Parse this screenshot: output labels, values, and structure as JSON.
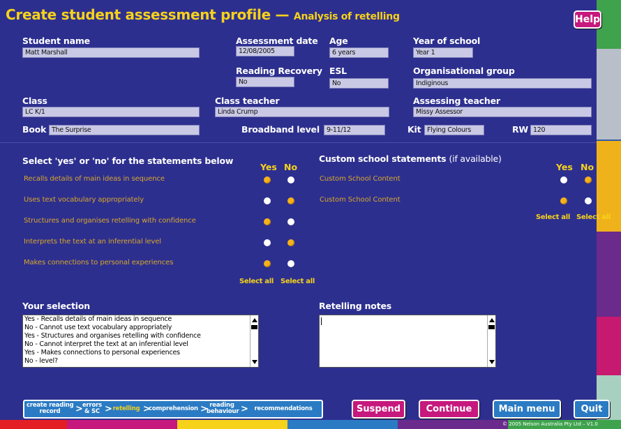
{
  "title": {
    "main": "Create student assessment profile",
    "dash": " — ",
    "sub": "Analysis of retelling"
  },
  "help_label": "Help",
  "fields": {
    "student_name": {
      "label": "Student name",
      "value": "Matt Marshall"
    },
    "assessment_date": {
      "label": "Assessment date",
      "value": "12/08/2005"
    },
    "age": {
      "label": "Age",
      "value": "6 years"
    },
    "year_of_school": {
      "label": "Year of school",
      "value": "Year 1"
    },
    "reading_recovery": {
      "label": "Reading Recovery",
      "value": "No"
    },
    "esl": {
      "label": "ESL",
      "value": "No"
    },
    "organisational_group": {
      "label": "Organisational group",
      "value": "Indiginous"
    },
    "class": {
      "label": "Class",
      "value": "LC K/1"
    },
    "class_teacher": {
      "label": "Class teacher",
      "value": "Linda Crump"
    },
    "assessing_teacher": {
      "label": "Assessing teacher",
      "value": "Missy Assessor"
    },
    "book": {
      "label": "Book",
      "value": "The Surprise"
    },
    "broadband_level": {
      "label": "Broadband level",
      "value": "9-11/12"
    },
    "kit": {
      "label": "Kit",
      "value": "Flying Colours"
    },
    "rw": {
      "label": "RW",
      "value": "120"
    }
  },
  "statements": {
    "heading": "Select 'yes' or 'no' for the statements below",
    "yes_label": "Yes",
    "no_label": "No",
    "items": [
      {
        "text": "Recalls details of main ideas in sequence",
        "selected": "yes"
      },
      {
        "text": "Uses text vocabulary appropriately",
        "selected": "no"
      },
      {
        "text": "Structures and organises retelling with confidence",
        "selected": "yes"
      },
      {
        "text": "Interprets the text at an inferential level",
        "selected": "no"
      },
      {
        "text": "Makes connections to personal experiences",
        "selected": "yes"
      }
    ],
    "select_all_yes": "Select all",
    "select_all_no": "Select all"
  },
  "custom": {
    "heading": "Custom school statements",
    "heading_note": "(if available)",
    "yes_label": "Yes",
    "no_label": "No",
    "items": [
      {
        "text": "Custom School Content",
        "selected": "no"
      },
      {
        "text": "Custom School Content",
        "selected": "yes"
      }
    ],
    "select_all_yes": "Select all",
    "select_all_no": "Select all"
  },
  "your_selection": {
    "heading": "Your selection",
    "lines": [
      "Yes - Recalls details of main ideas in sequence",
      "No - Cannot use text vocabulary appropriately",
      "Yes - Structures and organises retelling with confidence",
      "No - Cannot interpret the text at an inferential level",
      "Yes - Makes connections to personal experiences",
      "No - level?"
    ]
  },
  "retelling_notes": {
    "heading": "Retelling notes",
    "value": ""
  },
  "nav": {
    "items": [
      {
        "line1": "create reading",
        "line2": "record"
      },
      {
        "line1": "errors",
        "line2": "& SC"
      },
      {
        "line1": "retelling",
        "line2": ""
      },
      {
        "line1": "comprehension",
        "line2": ""
      },
      {
        "line1": "reading",
        "line2": "behaviour"
      },
      {
        "line1": "recommendations",
        "line2": ""
      }
    ],
    "sep": ">"
  },
  "buttons": {
    "suspend": "Suspend",
    "continue": "Continue",
    "main_menu": "Main menu",
    "quit": "Quit"
  },
  "copyright": "© 2005 Nelson Australia Pty Ltd – V1.0",
  "colors": {
    "background": "#2d2f8f",
    "title": "#f6d21a",
    "statement_text": "#d8a72a",
    "radio_selected": "#f6b21a",
    "button_pink": "#c6187d",
    "button_blue": "#2a7bc3",
    "strip": [
      "#3fa34d",
      "#b9bfc9",
      "#2f5ea8",
      "#f0b21a",
      "#6a2b8c",
      "#c7196f",
      "#a7d0c0"
    ],
    "bottom_bar": [
      "#e31e24",
      "#c6187d",
      "#f6d21a",
      "#2a7bc3",
      "#6a2b8c",
      "#3fa34d"
    ]
  }
}
